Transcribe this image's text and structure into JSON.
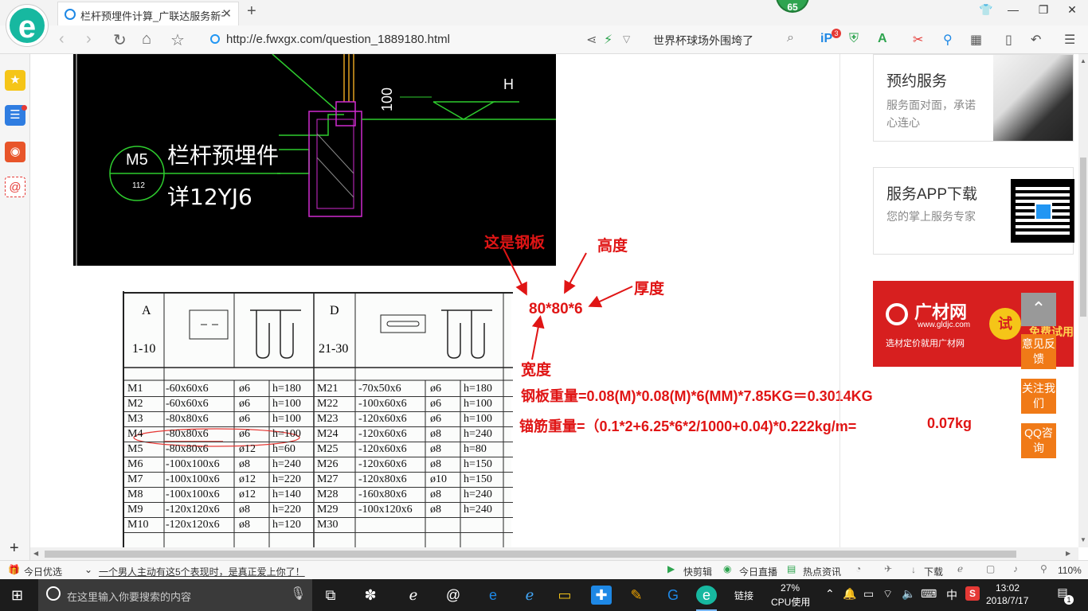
{
  "browser": {
    "tab_title": "栏杆预埋件计算_广联达服务新干线",
    "url": "http://e.fwxgx.com/question_1889180.html",
    "search_text": "世界杯球场外围垮了",
    "badge_count": "65",
    "ip_badge": "3",
    "zoom": "110%"
  },
  "cad": {
    "circle_label": "M5",
    "circle_num": "112",
    "line1": "栏杆预埋件",
    "line2": "详12YJ6",
    "dim": "100",
    "h_label": "H"
  },
  "table": {
    "head_a": "A",
    "head_a_range": "1-10",
    "head_d": "D",
    "head_d_range": "21-30",
    "rows": [
      [
        "M1",
        "-60x60x6",
        "ø6",
        "h=180",
        "M21",
        "-70x50x6",
        "ø6",
        "h=180"
      ],
      [
        "M2",
        "-60x60x6",
        "ø6",
        "h=100",
        "M22",
        "-100x60x6",
        "ø6",
        "h=100"
      ],
      [
        "M3",
        "-80x80x6",
        "ø6",
        "h=100",
        "M23",
        "-120x60x6",
        "ø6",
        "h=100"
      ],
      [
        "M4",
        "-80x80x6",
        "ø6",
        "h=100",
        "M24",
        "-120x60x6",
        "ø8",
        "h=240"
      ],
      [
        "M5",
        "-80x80x6",
        "ø12",
        "h=60",
        "M25",
        "-120x60x6",
        "ø8",
        "h=80"
      ],
      [
        "M6",
        "-100x100x6",
        "ø8",
        "h=240",
        "M26",
        "-120x60x6",
        "ø8",
        "h=150"
      ],
      [
        "M7",
        "-100x100x6",
        "ø12",
        "h=220",
        "M27",
        "-120x80x6",
        "ø10",
        "h=150"
      ],
      [
        "M8",
        "-100x100x6",
        "ø12",
        "h=140",
        "M28",
        "-160x80x6",
        "ø8",
        "h=240"
      ],
      [
        "M9",
        "-120x120x6",
        "ø8",
        "h=220",
        "M29",
        "-100x120x6",
        "ø8",
        "h=240"
      ],
      [
        "M10",
        "-120x120x6",
        "ø8",
        "h=120",
        "M30",
        "",
        "",
        ""
      ]
    ]
  },
  "annotations": {
    "steel_plate": "这是钢板",
    "height": "高度",
    "thickness": "厚度",
    "dims": "80*80*6",
    "width": "宽度",
    "plate_weight": "钢板重量=0.08(M)*0.08(M)*6(MM)*7.85KG＝0.3014KG",
    "rebar_weight": "锚筋重量=（0.1*2+6.25*6*2/1000+0.04)*0.222kg/m=",
    "rebar_result": "0.07kg"
  },
  "right_panel": {
    "booking_title": "预约服务",
    "booking_sub": "服务面对面，承诺心连心",
    "app_title": "服务APP下载",
    "app_sub": "您的掌上服务专家",
    "ad_brand": "广材网",
    "ad_url": "www.gldjc.com",
    "ad_slogan": "选材定价就用广材网",
    "ad_try": "试",
    "ad_side": "免费试用"
  },
  "float_buttons": {
    "feedback": "意见反馈",
    "follow": "关注我们",
    "qq": "QQ咨询"
  },
  "statusbar": {
    "today": "今日优选",
    "news": "一个男人主动有这5个表现时，是真正爱上你了！",
    "quick_clip": "快剪辑",
    "live": "今日直播",
    "hot": "热点资讯",
    "download": "下载",
    "zoom": "110%"
  },
  "taskbar": {
    "search_placeholder": "在这里输入你要搜索的内容",
    "link": "链接",
    "cpu_pct": "27%",
    "cpu_label": "CPU使用",
    "ime": "中",
    "time": "13:02",
    "date": "2018/7/17",
    "notif": "1"
  }
}
